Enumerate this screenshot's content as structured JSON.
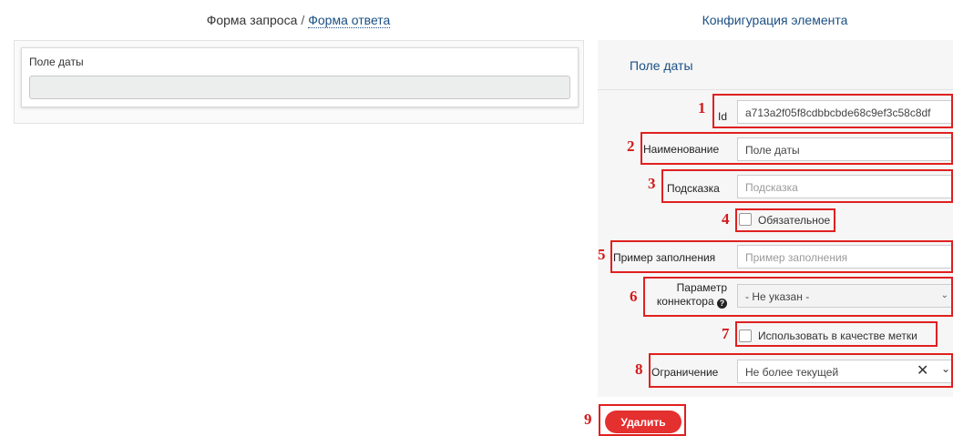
{
  "header": {
    "request_form": "Форма запроса",
    "separator": "/",
    "response_form": "Форма ответа",
    "element_config": "Конфигурация элемента"
  },
  "preview": {
    "field_label": "Поле даты"
  },
  "config": {
    "title": "Поле даты",
    "id": {
      "label": "Id",
      "value": "a713a2f05f8cdbbcbde68c9ef3c58c8df"
    },
    "name": {
      "label": "Наименование",
      "value": "Поле даты"
    },
    "hint": {
      "label": "Подсказка",
      "placeholder": "Подсказка"
    },
    "required": {
      "label": "Обязательное",
      "checked": false
    },
    "example": {
      "label": "Пример заполнения",
      "placeholder": "Пример заполнения"
    },
    "connector": {
      "label_line1": "Параметр",
      "label_line2": "коннектора",
      "info_icon": "question-circle-icon",
      "value": "- Не указан -"
    },
    "use_as_tag": {
      "label": "Использовать в качестве метки",
      "checked": false
    },
    "restriction": {
      "label": "Ограничение",
      "value": "Не более текущей"
    },
    "delete_button": "Удалить"
  },
  "annotations": [
    "1",
    "2",
    "3",
    "4",
    "5",
    "6",
    "7",
    "8",
    "9"
  ],
  "colors": {
    "accent_blue": "#1a4f84",
    "danger_red": "#e53030",
    "annotation_red": "#d41a1a"
  }
}
